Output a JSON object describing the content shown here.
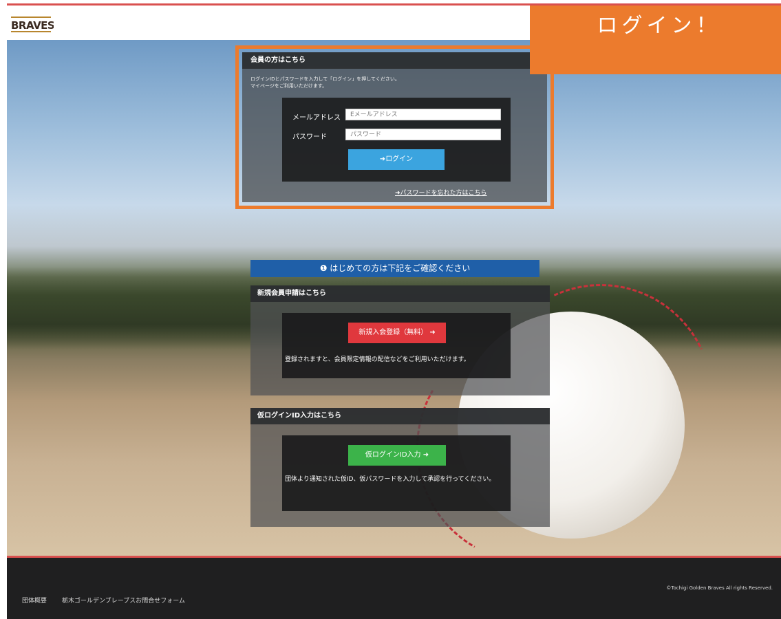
{
  "header": {
    "logo_text": "BRAVES"
  },
  "callout": {
    "text": "ログイン！"
  },
  "login": {
    "heading": "会員の方はこちら",
    "description_line1": "ログインIDとパスワードを入力して「ログイン」を押してください。",
    "description_line2": "マイページをご利用いただけます。",
    "email_label": "メールアドレス",
    "email_placeholder": "Eメールアドレス",
    "password_label": "パスワード",
    "password_placeholder": "パスワード",
    "login_button": "ログイン",
    "forgot_link": "パスワードを忘れた方はこちら"
  },
  "info_bar": {
    "text": "はじめての方は下記をご確認ください"
  },
  "register": {
    "heading": "新規会員申請はこちら",
    "button": "新規入会登録（無料）",
    "note": "登録されますと、会員限定情報の配信などをご利用いただけます。"
  },
  "temp_login": {
    "heading": "仮ログインID入力はこちら",
    "button": "仮ログインID入力",
    "note": "団体より通知された仮ID、仮パスワードを入力して承認を行ってください。"
  },
  "footer": {
    "link_about": "団体概要",
    "link_contact": "栃木ゴールデンブレーブスお問合せフォーム",
    "copyright": "©Tochigi Golden Braves All rights Reserved."
  },
  "colors": {
    "accent_orange": "#ec7b2d",
    "login_blue": "#3ba4df",
    "info_blue": "#1f5fa8",
    "register_red": "#e0383d",
    "temp_green": "#3cb34a",
    "header_red": "#d9504f"
  },
  "icons": {
    "login_button": "login-arrow-icon",
    "forgot_link": "arrow-right-icon",
    "info_bar": "info-circle-icon",
    "register_button": "arrow-right-icon",
    "temp_button": "arrow-right-icon"
  }
}
